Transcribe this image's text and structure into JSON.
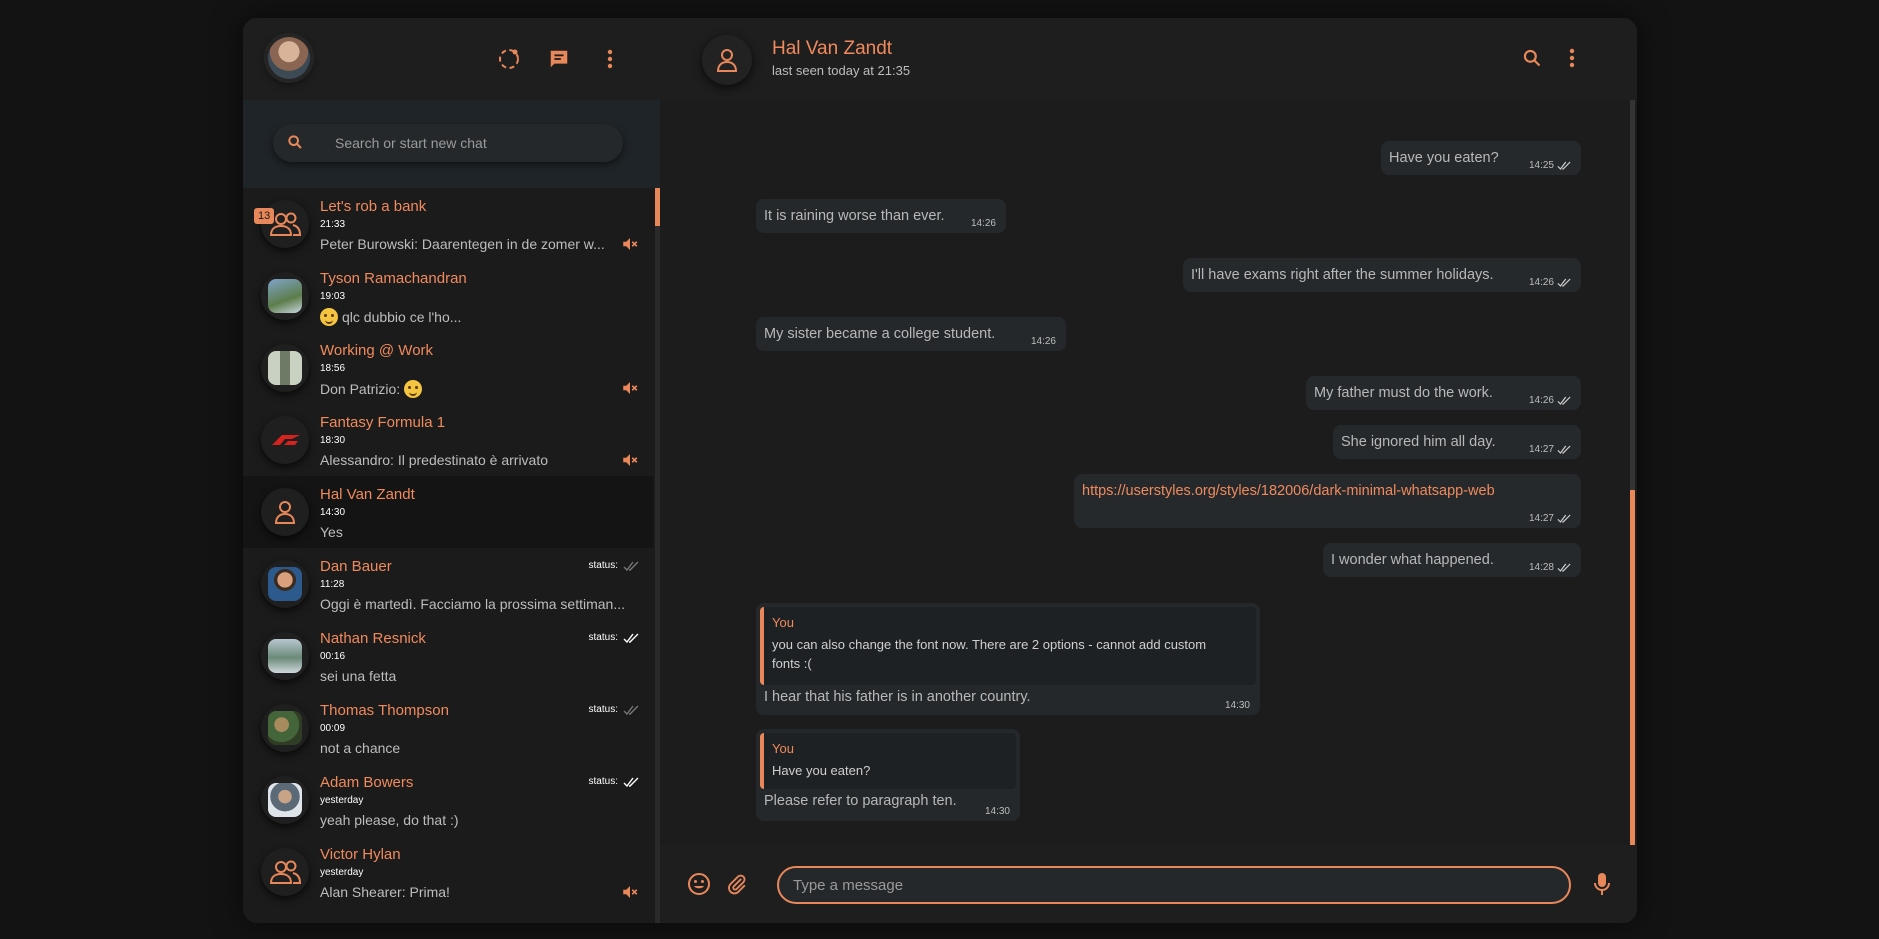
{
  "colors": {
    "accent": "#e8875a",
    "background": "#1b1b1b"
  },
  "sidebar": {
    "search_placeholder": "Search or start new chat",
    "chats": [
      {
        "name": "Let's rob a bank",
        "time": "21:33",
        "message": "Peter Burowski: Daarentegen in de zomer w...",
        "badge": "13",
        "muted": true,
        "avatar": "group-icon"
      },
      {
        "name": "Tyson Ramachandran",
        "time": "19:03",
        "message": "qlc dubbio ce l'ho...",
        "avatar": "photo"
      },
      {
        "name": "Working @ Work",
        "time": "18:56",
        "message": "Don Patrizio:",
        "muted": true,
        "avatar": "photo"
      },
      {
        "name": "Fantasy Formula 1",
        "time": "18:30",
        "message": "Alessandro: Il predestinato è arrivato",
        "muted": true,
        "avatar": "photo"
      },
      {
        "name": "Hal Van Zandt",
        "time": "14:30",
        "message": "Yes",
        "active": true,
        "avatar": "user-icon"
      },
      {
        "name": "Dan Bauer",
        "time": "11:28",
        "message": "Oggi è martedì. Facciamo la prossima settiman...",
        "status": "status:",
        "avatar": "photo"
      },
      {
        "name": "Nathan Resnick",
        "time": "00:16",
        "message": "sei una fetta",
        "status": "status:",
        "avatar": "photo"
      },
      {
        "name": "Thomas Thompson",
        "time": "00:09",
        "message": "not a chance",
        "status": "status:",
        "avatar": "photo"
      },
      {
        "name": "Adam Bowers",
        "time": "yesterday",
        "message": "yeah please, do that :)",
        "status": "status:",
        "avatar": "photo"
      },
      {
        "name": "Victor Hylan",
        "time": "yesterday",
        "message": "Alan Shearer: Prima!",
        "muted": true,
        "avatar": "group-icon"
      }
    ]
  },
  "conversation": {
    "name": "Hal Van Zandt",
    "last_seen": "last seen today at 21:35",
    "messages": [
      {
        "text": "Have you eaten?",
        "time": "14:25",
        "direction": "out"
      },
      {
        "text": "It is raining worse than ever.",
        "time": "14:26",
        "direction": "in"
      },
      {
        "text": "I'll have exams right after the summer holidays.",
        "time": "14:26",
        "direction": "out"
      },
      {
        "text": "My sister became a college student.",
        "time": "14:26",
        "direction": "in"
      },
      {
        "text": "My father must do the work.",
        "time": "14:26",
        "direction": "out"
      },
      {
        "text": "She ignored him all day.",
        "time": "14:27",
        "direction": "out"
      },
      {
        "text": "https://userstyles.org/styles/182006/dark-minimal-whatsapp-web",
        "time": "14:27",
        "direction": "out"
      },
      {
        "text": "I wonder what happened.",
        "time": "14:28",
        "direction": "out"
      },
      {
        "quote_author": "You",
        "quote_text": "you can also change the font now. There are 2 options - cannot add custom fonts :(",
        "text": "I hear that his father is in another country.",
        "time": "14:30",
        "direction": "in"
      },
      {
        "quote_author": "You",
        "quote_text": "Have you eaten?",
        "text": "Please refer to paragraph ten.",
        "time": "14:30",
        "direction": "in"
      }
    ],
    "composer_placeholder": "Type a message"
  }
}
